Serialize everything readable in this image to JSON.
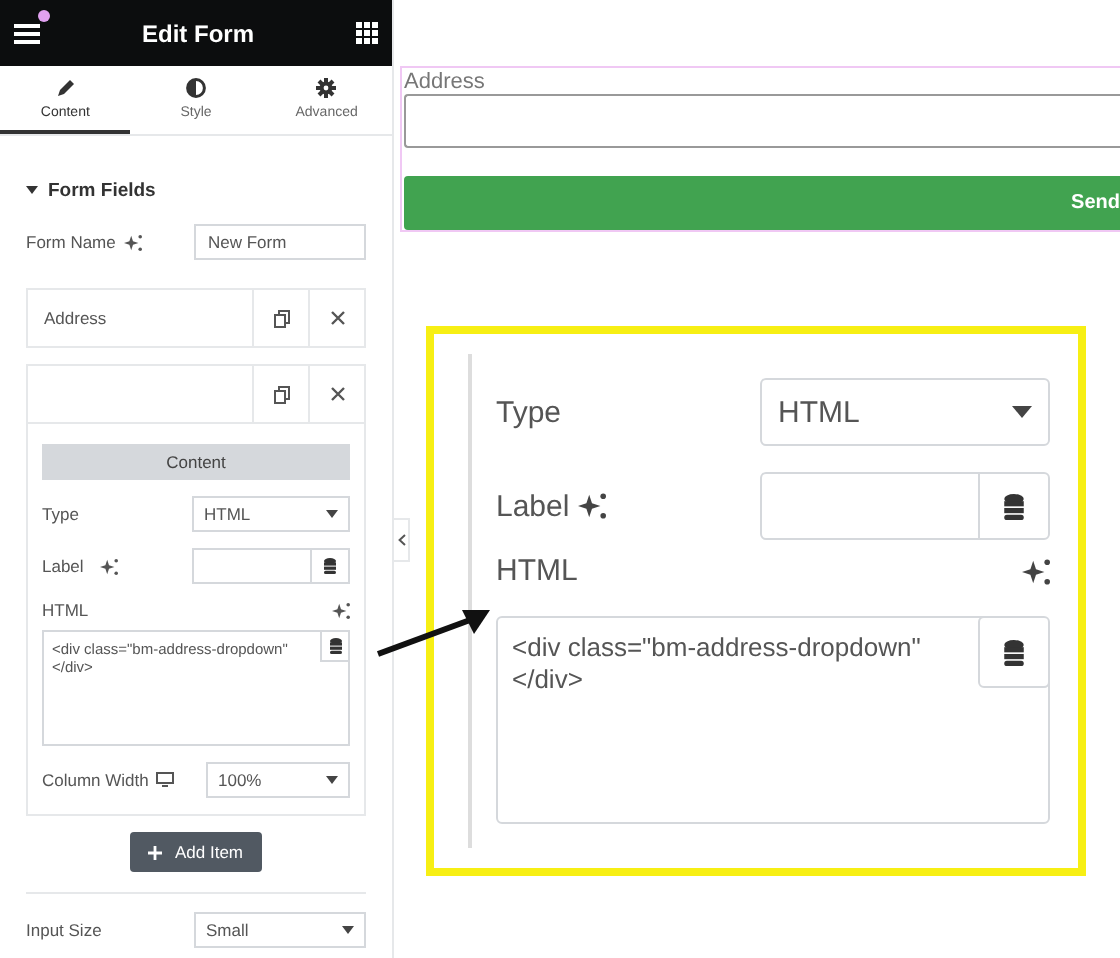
{
  "header": {
    "title": "Edit Form",
    "notification": true
  },
  "tabs": [
    {
      "label": "Content",
      "selected": true
    },
    {
      "label": "Style",
      "selected": false
    },
    {
      "label": "Advanced",
      "selected": false
    }
  ],
  "section": {
    "title": "Form Fields",
    "expanded": true
  },
  "form_name": {
    "label": "Form Name",
    "value": "New Form"
  },
  "fields": [
    {
      "label": "Address",
      "expanded": false
    },
    {
      "expanded": true
    }
  ],
  "editor": {
    "tab": "Content",
    "type": {
      "label": "Type",
      "value": "HTML"
    },
    "label_field": {
      "label": "Label"
    },
    "html": {
      "label": "HTML",
      "code": "<div class=\"bm-address-dropdown\"\n</div>"
    },
    "column_width": {
      "label": "Column Width",
      "value": "100%"
    }
  },
  "add_button": "Add Item",
  "input_size": {
    "label": "Input Size",
    "value": "Small"
  },
  "preview": {
    "field_label": "Address",
    "button": "Send"
  },
  "callout": {
    "type": {
      "label": "Type",
      "value": "HTML"
    },
    "label_field": {
      "label": "Label"
    },
    "html": {
      "label": "HTML",
      "code": "<div class=\"bm-address-dropdown\"\n</div>"
    }
  }
}
